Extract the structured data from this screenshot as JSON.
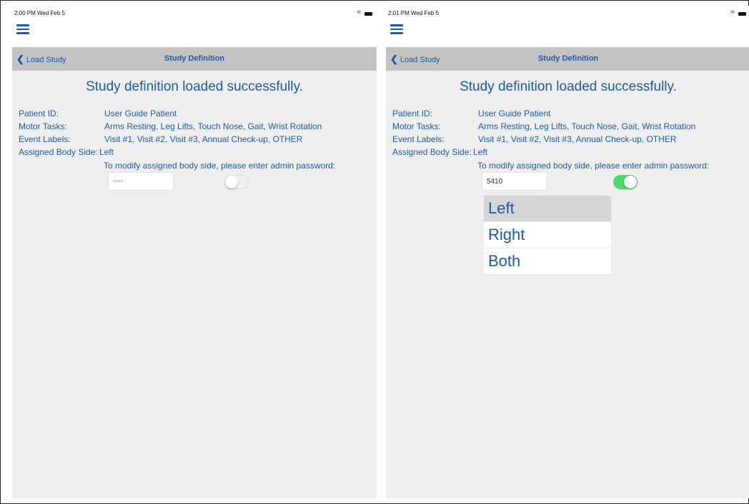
{
  "left": {
    "status": {
      "time": "2:00 PM  Wed Feb 5"
    },
    "nav": {
      "back": "Load Study",
      "title": "Study Definition"
    },
    "headline": "Study definition loaded successfully.",
    "fields": {
      "patient_label": "Patient ID:",
      "patient_value": "User Guide Patient",
      "motor_label": "Motor Tasks:",
      "motor_value": "Arms Resting, Leg Lifts, Touch Nose, Gait, Wrist Rotation",
      "event_label": "Event Labels:",
      "event_value": "Visit #1, Visit #2, Visit #3, Annual Check-up, OTHER",
      "side_label": "Assigned Body Side:",
      "side_value": "Left"
    },
    "hint": "To modify assigned body side, please enter admin password:",
    "password": {
      "value": "",
      "placeholder": "••••"
    },
    "toggle_on": false
  },
  "right": {
    "status": {
      "time": "2:01 PM  Wed Feb 5"
    },
    "nav": {
      "back": "Load Study",
      "title": "Study Definition"
    },
    "headline": "Study definition loaded successfully.",
    "fields": {
      "patient_label": "Patient ID:",
      "patient_value": "User Guide Patient",
      "motor_label": "Motor Tasks:",
      "motor_value": "Arms Resting, Leg Lifts, Touch Nose, Gait, Wrist Rotation",
      "event_label": "Event Labels:",
      "event_value": "Visit #1, Visit #2, Visit #3, Annual Check-up, OTHER",
      "side_label": "Assigned Body Side:",
      "side_value": "Left"
    },
    "hint": "To modify assigned body side, please enter admin password:",
    "password": {
      "value": "5410"
    },
    "toggle_on": true,
    "options": [
      "Left",
      "Right",
      "Both"
    ],
    "selected_option": "Left"
  },
  "colors": {
    "accent": "#1c5aa8",
    "navbar": "#c3c3c3",
    "content_bg": "#efefef",
    "toggle_on": "#4cd964"
  },
  "icons": {
    "menu": "hamburger-icon",
    "back": "chevron-left-icon",
    "wifi": "wifi-icon",
    "battery": "battery-icon"
  }
}
